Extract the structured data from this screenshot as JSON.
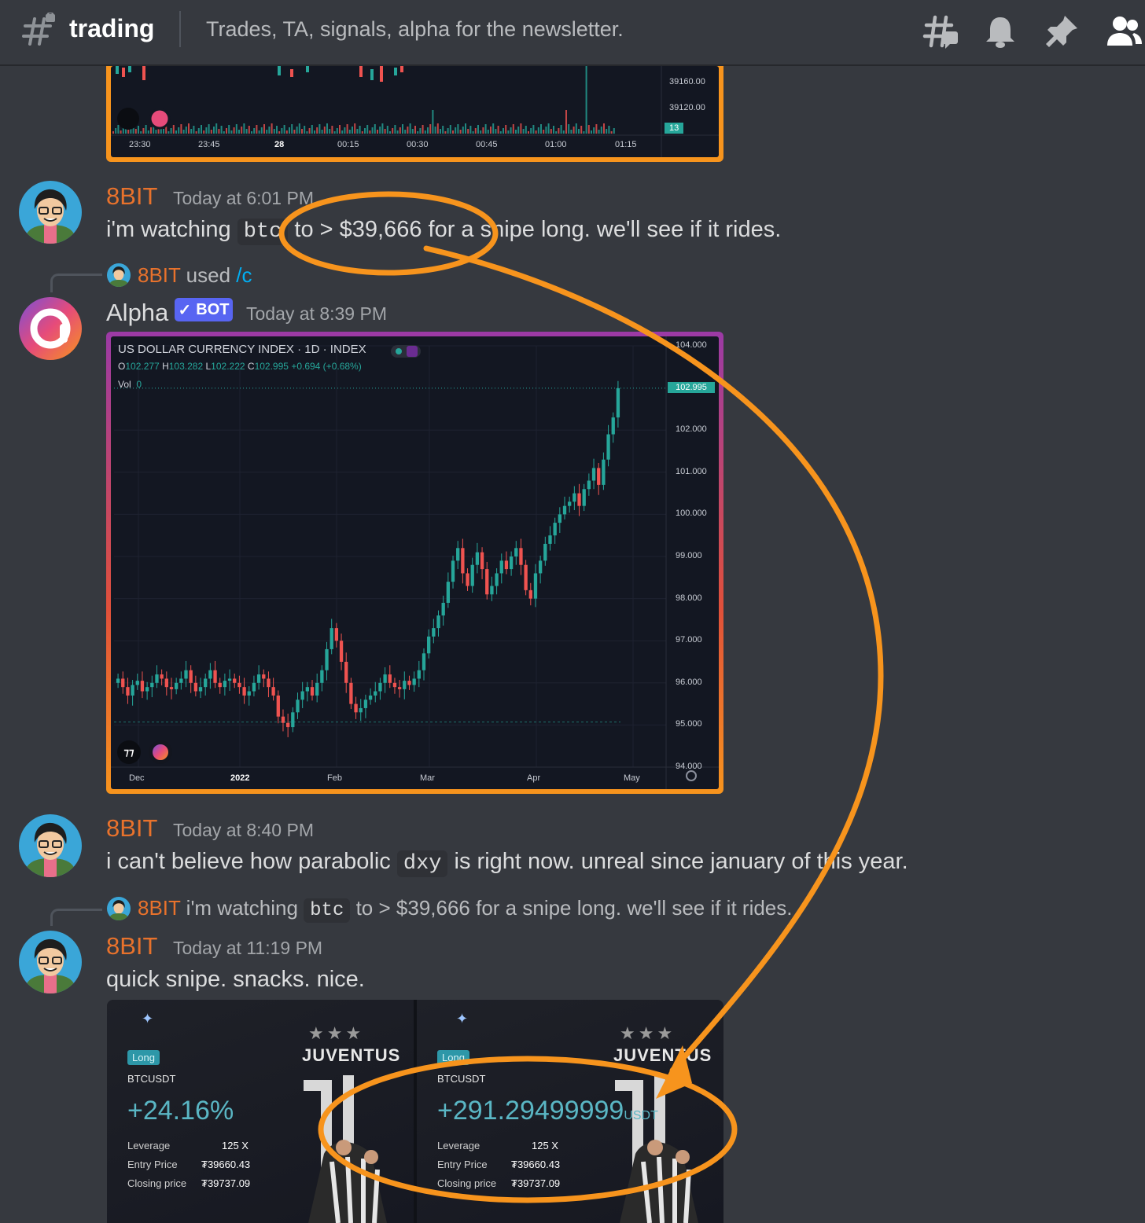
{
  "header": {
    "channel_name": "trading",
    "topic": "Trades, TA, signals, alpha for the newsletter."
  },
  "top_chart": {
    "price_labels": [
      "39160.00",
      "39120.00"
    ],
    "volume_badge": "13",
    "time_labels": [
      "23:30",
      "23:45",
      "28",
      "00:15",
      "00:30",
      "00:45",
      "01:00",
      "01:15"
    ]
  },
  "messages": [
    {
      "username": "8BIT",
      "timestamp": "Today at 6:01 PM",
      "text_before": "i'm watching ",
      "code": "btc",
      "text_after": " to > $39,666 for a snipe long. we'll see if it rides."
    },
    {
      "command_user": "8BIT",
      "command_used": "used",
      "command": "/c",
      "username": "Alpha",
      "badge": "BOT",
      "timestamp": "Today at 8:39 PM"
    },
    {
      "username": "8BIT",
      "timestamp": "Today at 8:40 PM",
      "text_before": "i can't believe how parabolic ",
      "code": "dxy",
      "text_after": " is right now. unreal since january of this year."
    },
    {
      "reply_user": "8BIT",
      "reply_before": "i'm watching ",
      "reply_code": "btc",
      "reply_after": " to > $39,666 for a snipe long. we'll see if it rides.",
      "username": "8BIT",
      "timestamp": "Today at 11:19 PM",
      "text": "quick snipe. snacks. nice."
    }
  ],
  "chart_data": {
    "type": "candlestick",
    "title": "US DOLLAR CURRENCY INDEX · 1D · INDEX",
    "ohlc_line": {
      "o_label": "O",
      "o": "102.277",
      "h_label": "H",
      "h": "103.282",
      "l_label": "L",
      "l": "102.222",
      "c_label": "C",
      "c": "102.995",
      "change": "+0.694 (+0.68%)"
    },
    "volume_label": "Vol",
    "volume_value": "0",
    "last_price": "102.995",
    "y_ticks": [
      "104.000",
      "102.000",
      "101.000",
      "100.000",
      "99.000",
      "98.000",
      "97.000",
      "96.000",
      "95.000",
      "94.000"
    ],
    "x_ticks": [
      "Dec",
      "2022",
      "Feb",
      "Mar",
      "Apr",
      "May"
    ],
    "ylim": [
      94.0,
      104.0
    ],
    "close_series": [
      96.1,
      95.9,
      95.7,
      95.95,
      96.05,
      95.8,
      95.9,
      96.0,
      96.2,
      96.1,
      95.9,
      95.85,
      96.0,
      96.1,
      96.3,
      96.0,
      95.8,
      95.9,
      96.1,
      96.3,
      96.0,
      95.9,
      96.05,
      96.1,
      96.0,
      95.9,
      95.7,
      95.8,
      96.0,
      96.2,
      96.1,
      95.9,
      95.7,
      95.2,
      95.05,
      94.95,
      95.3,
      95.6,
      95.8,
      95.9,
      95.7,
      96.0,
      96.3,
      96.8,
      97.3,
      97.0,
      96.5,
      96.0,
      95.5,
      95.3,
      95.4,
      95.6,
      95.7,
      95.8,
      96.0,
      96.2,
      96.0,
      95.9,
      95.85,
      96.05,
      95.95,
      96.1,
      96.3,
      96.7,
      97.1,
      97.3,
      97.6,
      97.9,
      98.4,
      98.9,
      99.2,
      98.6,
      98.3,
      98.8,
      99.1,
      98.7,
      98.1,
      98.3,
      98.6,
      98.9,
      98.7,
      99.0,
      99.2,
      98.8,
      98.2,
      98.0,
      98.6,
      98.9,
      99.3,
      99.5,
      99.8,
      100.0,
      100.2,
      100.3,
      100.5,
      100.2,
      100.6,
      100.8,
      101.1,
      100.7,
      101.3,
      101.9,
      102.3,
      102.995
    ]
  },
  "trade_cards": [
    {
      "tag": "Long",
      "pair": "BTCUSDT",
      "pnl": "+24.16%",
      "leverage_label": "Leverage",
      "leverage": "125 X",
      "entry_label": "Entry Price",
      "entry": "₮39660.43",
      "closing_label": "Closing price",
      "closing": "₮39737.09",
      "brand": "JUVENTUS"
    },
    {
      "tag": "Long",
      "pair": "BTCUSDT",
      "pnl": "+291.29499999",
      "pnl_unit": "USDT",
      "leverage_label": "Leverage",
      "leverage": "125 X",
      "entry_label": "Entry Price",
      "entry": "₮39660.43",
      "closing_label": "Closing price",
      "closing": "₮39737.09",
      "brand": "JUVENTUS"
    }
  ],
  "colors": {
    "accent_orange": "#f7941d",
    "username_orange": "#e8722c",
    "bot_blue": "#5865f2",
    "candle_up": "#26a69a",
    "candle_down": "#ef5350"
  }
}
